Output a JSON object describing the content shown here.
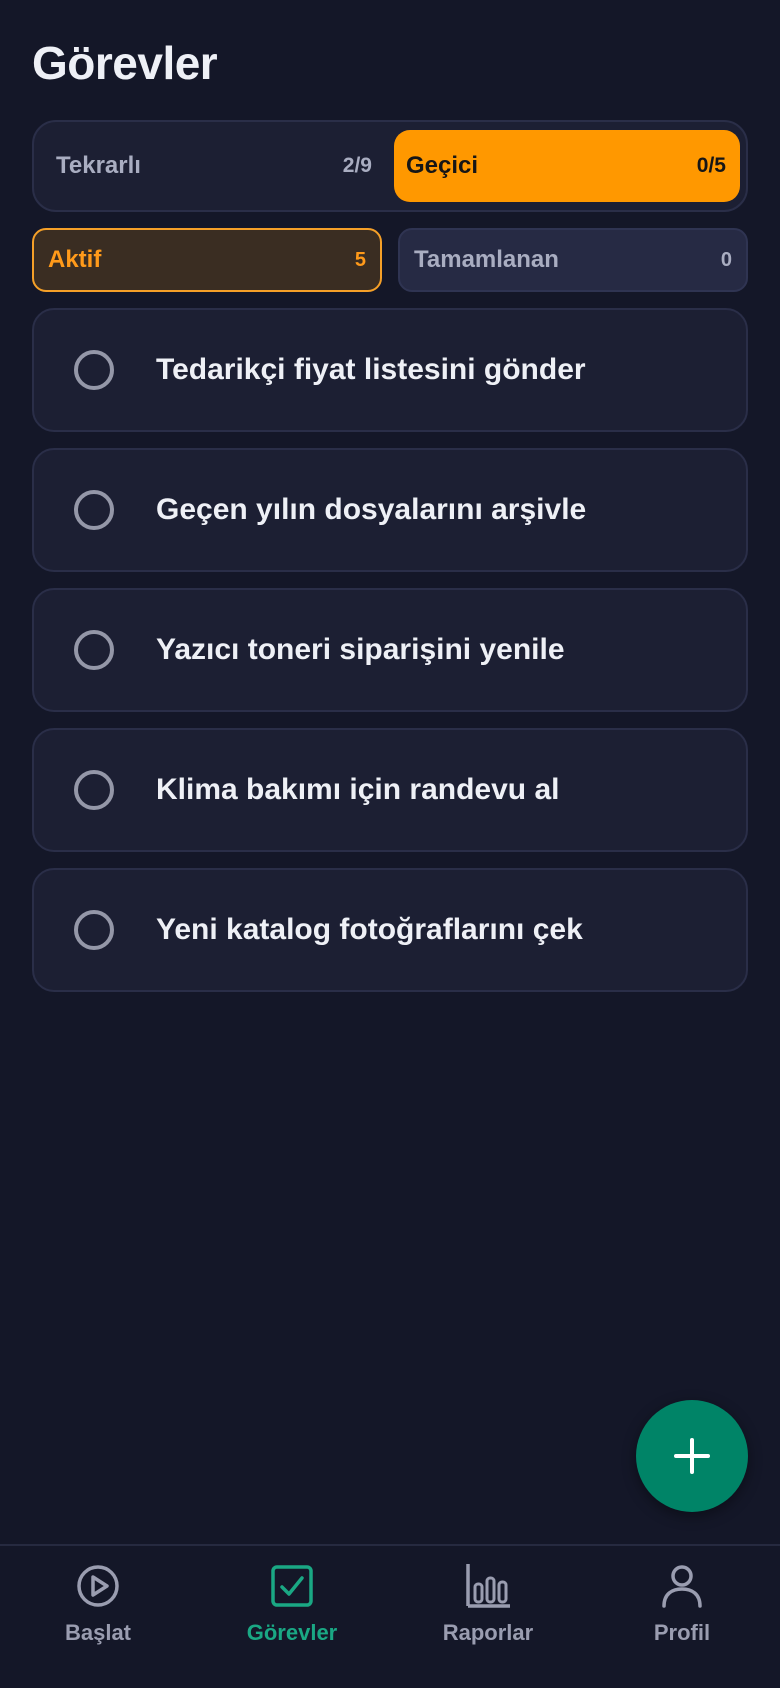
{
  "header": {
    "title": "Görevler"
  },
  "segments": {
    "items": [
      {
        "label": "Tekrarlı",
        "count": "2/9",
        "selected": false
      },
      {
        "label": "Geçici",
        "count": "0/5",
        "selected": true
      }
    ]
  },
  "filters": {
    "items": [
      {
        "label": "Aktif",
        "count": "5",
        "selected": true
      },
      {
        "label": "Tamamlanan",
        "count": "0",
        "selected": false
      }
    ]
  },
  "tasks": [
    {
      "title": "Tedarikçi fiyat listesini gönder",
      "done": false
    },
    {
      "title": "Geçen yılın dosyalarını arşivle",
      "done": false
    },
    {
      "title": "Yazıcı toneri siparişini yenile",
      "done": false
    },
    {
      "title": "Klima bakımı için randevu al",
      "done": false
    },
    {
      "title": "Yeni katalog fotoğraflarını çek",
      "done": false
    }
  ],
  "fab": {
    "icon": "plus-icon"
  },
  "bottom_nav": {
    "items": [
      {
        "label": "Başlat",
        "icon": "play-circle-icon",
        "selected": false
      },
      {
        "label": "Görevler",
        "icon": "checkbox-icon",
        "selected": true
      },
      {
        "label": "Raporlar",
        "icon": "bar-chart-icon",
        "selected": false
      },
      {
        "label": "Profil",
        "icon": "person-icon",
        "selected": false
      }
    ]
  },
  "colors": {
    "background": "#141728",
    "card": "#1c1f33",
    "accent_orange": "#ff9800",
    "accent_green": "#008467",
    "nav_selected": "#1aa884"
  }
}
